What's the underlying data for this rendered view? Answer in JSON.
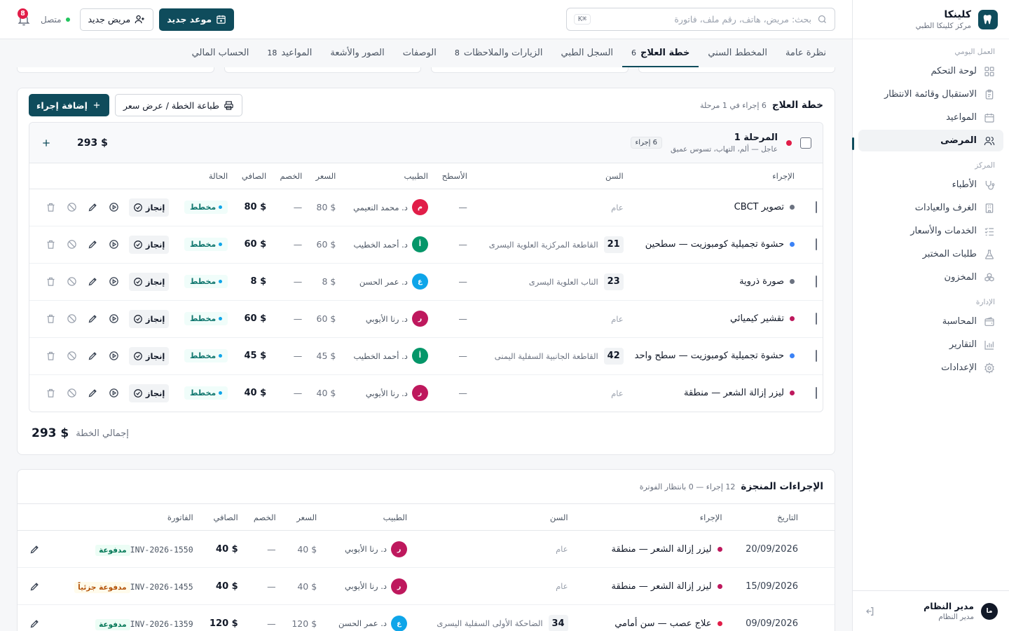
{
  "brand": {
    "name": "كلينكا",
    "subtitle": "مركز كلينكا الطبي"
  },
  "sidebar": {
    "sections": [
      {
        "label": "العمل اليومي",
        "items": [
          {
            "label": "لوحة التحكم",
            "icon": "grid-icon"
          },
          {
            "label": "الاستقبال وقائمة الانتظار",
            "icon": "clipboard-icon"
          },
          {
            "label": "المواعيد",
            "icon": "calendar-icon"
          },
          {
            "label": "المرضى",
            "icon": "users-icon",
            "active": true
          }
        ]
      },
      {
        "label": "المركز",
        "items": [
          {
            "label": "الأطباء",
            "icon": "stethoscope-icon"
          },
          {
            "label": "الغرف والعيادات",
            "icon": "building-icon"
          },
          {
            "label": "الخدمات والأسعار",
            "icon": "list-check-icon"
          },
          {
            "label": "طلبات المختبر",
            "icon": "flask-icon"
          },
          {
            "label": "المخزون",
            "icon": "boxes-icon"
          }
        ]
      },
      {
        "label": "الإدارة",
        "items": [
          {
            "label": "المحاسبة",
            "icon": "wallet-icon"
          },
          {
            "label": "التقارير",
            "icon": "bar-chart-icon"
          },
          {
            "label": "الإعدادات",
            "icon": "gear-icon"
          }
        ]
      }
    ],
    "user": {
      "initials": "ما",
      "name": "مدير النظام",
      "role": "مدير النظام"
    }
  },
  "topbar": {
    "search_placeholder": "بحث: مريض، هاتف، رقم ملف، فاتورة",
    "shortcut": "⌘K",
    "new_appointment": "موعد جديد",
    "new_patient": "مريض جديد",
    "online_label": "متصل",
    "notifications": "8"
  },
  "tabs": [
    {
      "label": "نظرة عامة"
    },
    {
      "label": "المخطط السني"
    },
    {
      "label": "خطة العلاج",
      "count": "6",
      "active": true
    },
    {
      "label": "السجل الطبي"
    },
    {
      "label": "الزيارات والملاحظات",
      "count": "8"
    },
    {
      "label": "الوصفات"
    },
    {
      "label": "الصور والأشعة"
    },
    {
      "label": "المواعيد",
      "count": "18"
    },
    {
      "label": "الحساب المالي"
    }
  ],
  "plan": {
    "title": "خطة العلاج",
    "subtitle": "6 إجراء في 1 مرحلة",
    "print_label": "طباعة الخطة / عرض سعر",
    "add_label": "إضافة إجراء",
    "phase": {
      "title": "المرحلة 1",
      "subtitle": "عاجل — ألم، التهاب، تسوس عميق",
      "count": "6 إجراء",
      "total": "$ 293",
      "dot_color": "#e11d48"
    },
    "columns": [
      "الإجراء",
      "السن",
      "الأسطح",
      "الطبيب",
      "السعر",
      "الخصم",
      "الصافي",
      "الحالة"
    ],
    "rows": [
      {
        "procedure": "تصوير CBCT",
        "dot": "#6b7280",
        "tooth": "",
        "tooth_desc": "عام",
        "surfaces": "—",
        "doctor": "د. محمد النعيمي",
        "doc_initial": "م",
        "doc_color": "#e11d48",
        "price": "$ 80",
        "discount": "—",
        "net": "$ 80",
        "status": "مخطط",
        "done": "إنجاز"
      },
      {
        "procedure": "حشوة تجميلية كومبوزيت — سطحين",
        "dot": "#3b82f6",
        "tooth": "21",
        "tooth_desc": "القاطعة المركزية العلوية اليسرى",
        "surfaces": "—",
        "doctor": "د. أحمد الخطيب",
        "doc_initial": "أ",
        "doc_color": "#059669",
        "price": "$ 60",
        "discount": "—",
        "net": "$ 60",
        "status": "مخطط",
        "done": "إنجاز"
      },
      {
        "procedure": "صورة ذروية",
        "dot": "#6b7280",
        "tooth": "23",
        "tooth_desc": "الناب العلوية اليسرى",
        "surfaces": "—",
        "doctor": "د. عمر الحسن",
        "doc_initial": "ع",
        "doc_color": "#0ea5e9",
        "price": "$ 8",
        "discount": "—",
        "net": "$ 8",
        "status": "مخطط",
        "done": "إنجاز"
      },
      {
        "procedure": "تقشير كيميائي",
        "dot": "#be185d",
        "tooth": "",
        "tooth_desc": "عام",
        "surfaces": "—",
        "doctor": "د. رنا الأيوبي",
        "doc_initial": "ر",
        "doc_color": "#be185d",
        "price": "$ 60",
        "discount": "—",
        "net": "$ 60",
        "status": "مخطط",
        "done": "إنجاز"
      },
      {
        "procedure": "حشوة تجميلية كومبوزيت — سطح واحد",
        "dot": "#3b82f6",
        "tooth": "42",
        "tooth_desc": "القاطعة الجانبية السفلية اليمنى",
        "surfaces": "—",
        "doctor": "د. أحمد الخطيب",
        "doc_initial": "أ",
        "doc_color": "#059669",
        "price": "$ 45",
        "discount": "—",
        "net": "$ 45",
        "status": "مخطط",
        "done": "إنجاز"
      },
      {
        "procedure": "ليزر إزالة الشعر — منطقة",
        "dot": "#be185d",
        "tooth": "",
        "tooth_desc": "عام",
        "surfaces": "—",
        "doctor": "د. رنا الأيوبي",
        "doc_initial": "ر",
        "doc_color": "#be185d",
        "price": "$ 40",
        "discount": "—",
        "net": "$ 40",
        "status": "مخطط",
        "done": "إنجاز"
      }
    ],
    "total_label": "إجمالي الخطة",
    "total_value": "$ 293"
  },
  "completed": {
    "title": "الإجراءات المنجزة",
    "subtitle": "12 إجراء — 0 بانتظار الفوترة",
    "columns": [
      "التاريخ",
      "الإجراء",
      "السن",
      "الطبيب",
      "السعر",
      "الخصم",
      "الصافي",
      "الفاتورة"
    ],
    "rows": [
      {
        "date": "20/09/2026",
        "procedure": "ليزر إزالة الشعر — منطقة",
        "dot": "#be185d",
        "tooth": "",
        "tooth_desc": "عام",
        "doctor": "د. رنا الأيوبي",
        "doc_initial": "ر",
        "doc_color": "#be185d",
        "price": "$ 40",
        "discount": "—",
        "net": "$ 40",
        "invoice": "INV-2026-1550",
        "paid": "مدفوعة",
        "paid_bg": "#ecfdf5",
        "paid_fg": "#047857"
      },
      {
        "date": "15/09/2026",
        "procedure": "ليزر إزالة الشعر — منطقة",
        "dot": "#be185d",
        "tooth": "",
        "tooth_desc": "عام",
        "doctor": "د. رنا الأيوبي",
        "doc_initial": "ر",
        "doc_color": "#be185d",
        "price": "$ 40",
        "discount": "—",
        "net": "$ 40",
        "invoice": "INV-2026-1455",
        "paid": "مدفوعة جزئياً",
        "paid_bg": "#fffbeb",
        "paid_fg": "#b45309"
      },
      {
        "date": "09/09/2026",
        "procedure": "علاج عصب — سن أمامي",
        "dot": "#e11d48",
        "tooth": "34",
        "tooth_desc": "الضاحكة الأولى السفلية اليسرى",
        "doctor": "د. عمر الحسن",
        "doc_initial": "ع",
        "doc_color": "#0ea5e9",
        "price": "$ 120",
        "discount": "—",
        "net": "$ 120",
        "invoice": "INV-2026-1359",
        "paid": "مدفوعة",
        "paid_bg": "#ecfdf5",
        "paid_fg": "#047857"
      }
    ]
  },
  "colors": {
    "primary": "#0f4c5c",
    "danger": "#e11d48",
    "online": "#22c55e"
  }
}
